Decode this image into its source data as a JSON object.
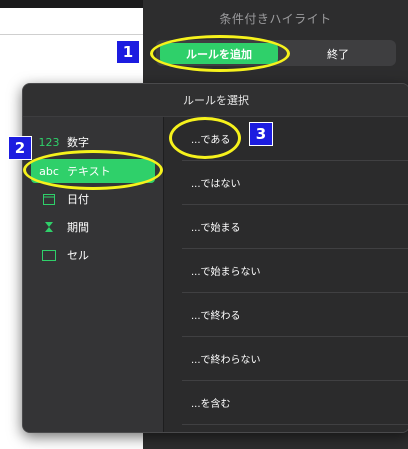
{
  "panel": {
    "title": "条件付きハイライト",
    "add_rule_button": "ルールを追加",
    "done_button": "終了"
  },
  "popover": {
    "title": "ルールを選択",
    "categories": [
      {
        "icon": "123",
        "label": "数字"
      },
      {
        "icon": "abc",
        "label": "テキスト"
      },
      {
        "icon": "calendar-icon",
        "label": "日付"
      },
      {
        "icon": "hourglass-icon",
        "label": "期間"
      },
      {
        "icon": "cell-icon",
        "label": "セル"
      }
    ],
    "selected_category": "テキスト",
    "rules": [
      "...である",
      "...ではない",
      "...で始まる",
      "...で始まらない",
      "...で終わる",
      "...で終わらない",
      "...を含む"
    ]
  },
  "annotations": {
    "badge_1": "1",
    "badge_2": "2",
    "badge_3": "3"
  },
  "colors": {
    "accent": "#2fd06a",
    "annotation_ring": "#f6f21c",
    "badge": "#1c1ce0"
  }
}
